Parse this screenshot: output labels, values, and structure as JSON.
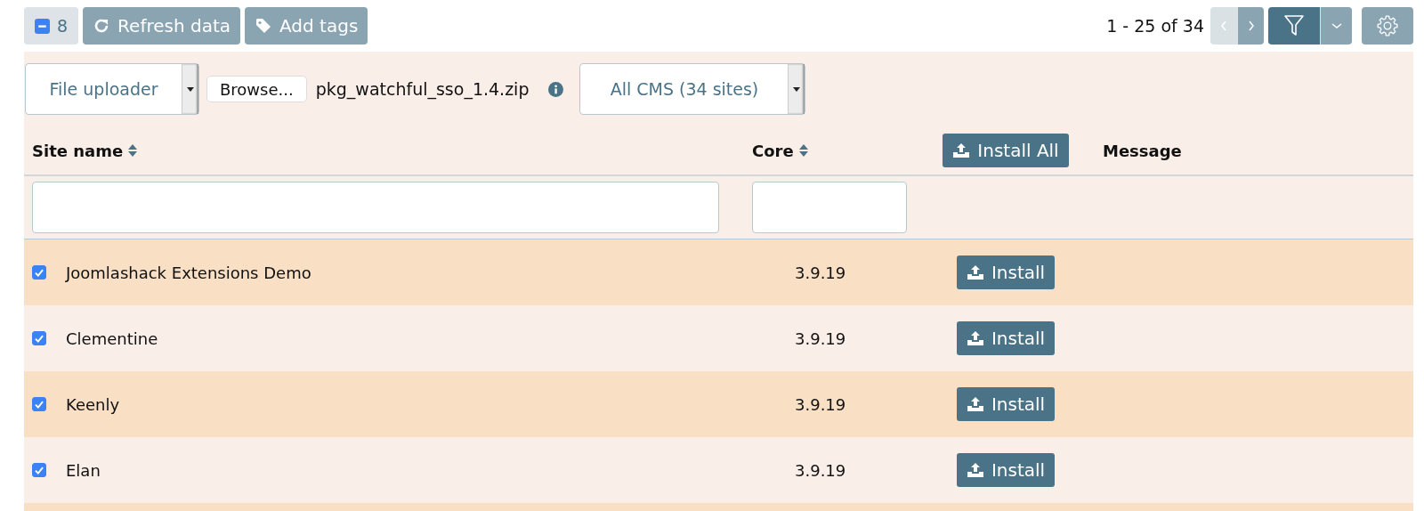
{
  "toolbar": {
    "selection_count": "8",
    "refresh_label": "Refresh data",
    "tags_label": "Add tags",
    "pagination": "1 - 25 of 34",
    "prev_disabled": true,
    "next_disabled": false
  },
  "upload": {
    "source": "File uploader",
    "browse_label": "Browse...",
    "file_name": "pkg_watchful_sso_1.4.zip",
    "cms_filter": "All CMS (34 sites)"
  },
  "table": {
    "columns": [
      "Site name",
      "Core",
      "Install All",
      "Message"
    ],
    "rows": [
      {
        "checked": true,
        "site": "Joomlashack Extensions Demo",
        "core": "3.9.19",
        "action": "Install"
      },
      {
        "checked": true,
        "site": "Clementine",
        "core": "3.9.19",
        "action": "Install"
      },
      {
        "checked": true,
        "site": "Keenly",
        "core": "3.9.19",
        "action": "Install"
      },
      {
        "checked": true,
        "site": "Elan",
        "core": "3.9.19",
        "action": "Install"
      }
    ]
  }
}
